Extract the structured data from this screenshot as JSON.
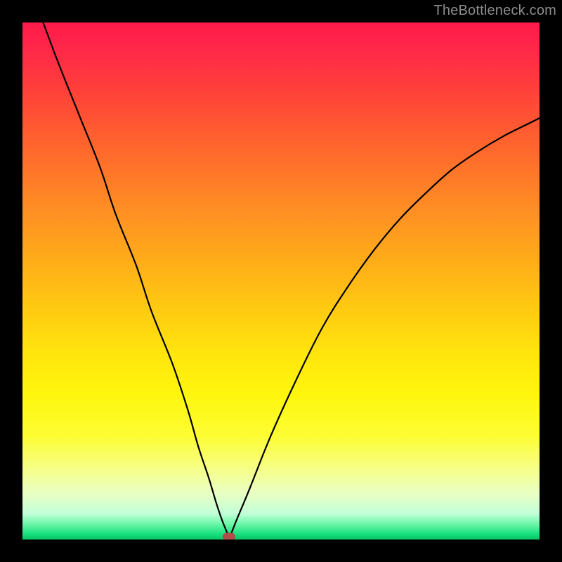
{
  "watermark": "TheBottleneck.com",
  "chart_data": {
    "type": "line",
    "title": "",
    "xlabel": "",
    "ylabel": "",
    "xlim": [
      0,
      100
    ],
    "ylim": [
      0,
      100
    ],
    "grid": false,
    "legend": false,
    "series": [
      {
        "name": "bottleneck-curve",
        "x": [
          4,
          7,
          11,
          15,
          18,
          22,
          25,
          29,
          32,
          34,
          36,
          37.5,
          38.5,
          39.5,
          40,
          40.5,
          41.5,
          44,
          48,
          53,
          58,
          63,
          68,
          73,
          78,
          83,
          88,
          93,
          98,
          100
        ],
        "y": [
          100,
          92,
          82,
          72,
          63,
          53,
          44,
          34,
          25,
          18,
          12,
          7,
          4,
          1.5,
          0.5,
          1.5,
          4,
          10,
          20,
          31,
          41,
          49,
          56,
          62,
          67,
          71.5,
          75,
          78,
          80.5,
          81.5
        ]
      }
    ],
    "marker": {
      "x": 40,
      "y": 0.5,
      "color": "#b24b4b"
    },
    "background_gradient": {
      "top": "#ff1a4b",
      "mid": "#ffe50d",
      "bottom": "#0bc264"
    }
  }
}
